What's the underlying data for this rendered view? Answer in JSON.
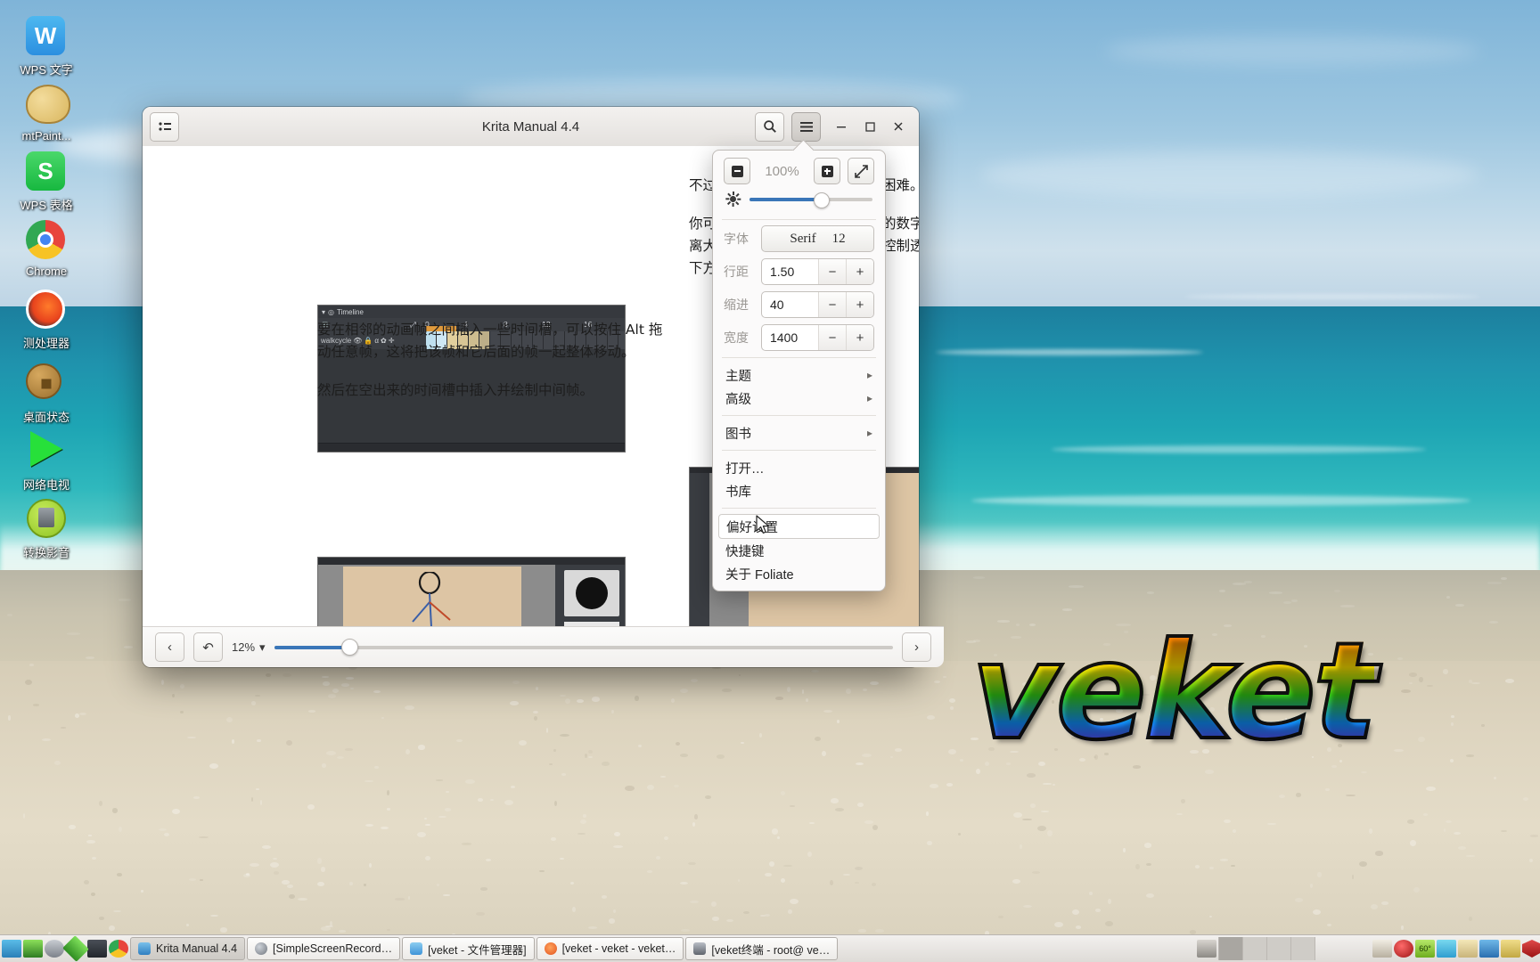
{
  "desktop": {
    "icons": [
      {
        "label": "WPS 文字",
        "icon": "wps-writer-icon"
      },
      {
        "label": "mtPaint...",
        "icon": "mtpaint-icon"
      },
      {
        "label": "WPS 表格",
        "icon": "wps-spreadsheet-icon"
      },
      {
        "label": "Chrome",
        "icon": "chrome-icon"
      },
      {
        "label": "测处理器",
        "icon": "processor-icon"
      },
      {
        "label": "桌面状态",
        "icon": "desktop-status-icon"
      },
      {
        "label": "网络电视",
        "icon": "network-tv-icon"
      },
      {
        "label": "转换影音",
        "icon": "media-converter-icon"
      }
    ],
    "logo_text": "veket"
  },
  "window": {
    "title": "Krita Manual 4.4",
    "titlebar": {
      "sidebar_toggle": "sidebar-toggle-icon",
      "search": "search-icon",
      "menu": "hamburger-menu-icon",
      "minimize": "—",
      "maximize": "▢",
      "close": "✕"
    }
  },
  "content": {
    "left_column": [
      "要在相邻的动画帧之间插入一些时间槽，可以按住 Alt 拖动任意帧，这将把该帧和它后面的帧一起整体移动。",
      "然后在空出来的时间槽中插入并绘制中间帧。"
    ],
    "right_column": [
      "不过你很快会发现，插入的帧越困难。",
      "你可以用洋葱皮面板对洋葱皮栏的数字可以控制该帧数距离大，意味着它与当前帧离得越控制透明度的变化。面板下方和着色强度。"
    ],
    "timeline_image": {
      "panel_title": "Timeline",
      "layer_name": "walkcycle",
      "ruler_ticks": [
        "0",
        "4",
        "8",
        "12",
        "16"
      ]
    }
  },
  "footer": {
    "back": "‹",
    "undo": "↶",
    "percent": "12%",
    "dropdown": "▾",
    "next": "›",
    "progress_fill": 12
  },
  "menu": {
    "zoom_out": "zoom-out-icon",
    "zoom_value": "100%",
    "zoom_in": "zoom-in-icon",
    "fullscreen": "expand-icon",
    "brightness_icon": "brightness-icon",
    "brightness_value": 58,
    "fields": [
      {
        "label": "字体",
        "type": "font",
        "value": "Serif",
        "size": "12"
      },
      {
        "label": "行距",
        "type": "spin",
        "value": "1.50"
      },
      {
        "label": "缩进",
        "type": "spin",
        "value": "40"
      },
      {
        "label": "宽度",
        "type": "spin",
        "value": "1400"
      }
    ],
    "spin_minus": "−",
    "spin_plus": "+",
    "items": [
      {
        "label": "主题",
        "submenu": true
      },
      {
        "label": "高级",
        "submenu": true
      },
      {
        "label": "图书",
        "submenu": true
      },
      {
        "label": "打开…",
        "submenu": false
      },
      {
        "label": "书库",
        "submenu": false
      },
      {
        "label": "偏好设置",
        "submenu": false,
        "selected": true
      },
      {
        "label": "快捷键",
        "submenu": false
      },
      {
        "label": "关于 Foliate",
        "submenu": false
      }
    ],
    "submenu_arrow": "▸"
  },
  "taskbar": {
    "tasks": [
      {
        "label": "Krita Manual 4.4",
        "active": true,
        "color": "#6aa8d8"
      },
      {
        "label": "[SimpleScreenRecord…",
        "active": false,
        "color": "#8a8f96"
      },
      {
        "label": "[veket - 文件管理器]",
        "active": false,
        "color": "#5aa8e0"
      },
      {
        "label": "[veket - veket - veket…",
        "active": false,
        "color": "#e8683c"
      },
      {
        "label": "[veket终端 - root@ ve…",
        "active": false,
        "color": "#767676"
      }
    ]
  }
}
